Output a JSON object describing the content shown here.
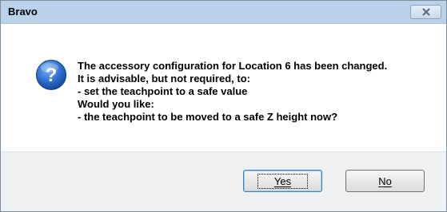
{
  "window": {
    "title": "Bravo",
    "close_icon": "close-icon"
  },
  "dialog": {
    "icon": "question-icon",
    "message_lines": [
      "The accessory configuration for Location 6 has been changed.",
      "It is advisable, but not required, to:",
      "- set the teachpoint to a safe value",
      "Would you like:",
      "- the teachpoint to be moved to a safe Z height now?"
    ]
  },
  "buttons": {
    "yes_label": "Yes",
    "no_label": "No"
  },
  "colors": {
    "titlebar": "#b9d1ea",
    "icon_blue": "#1f5fb8",
    "footer": "#eef0f2"
  }
}
